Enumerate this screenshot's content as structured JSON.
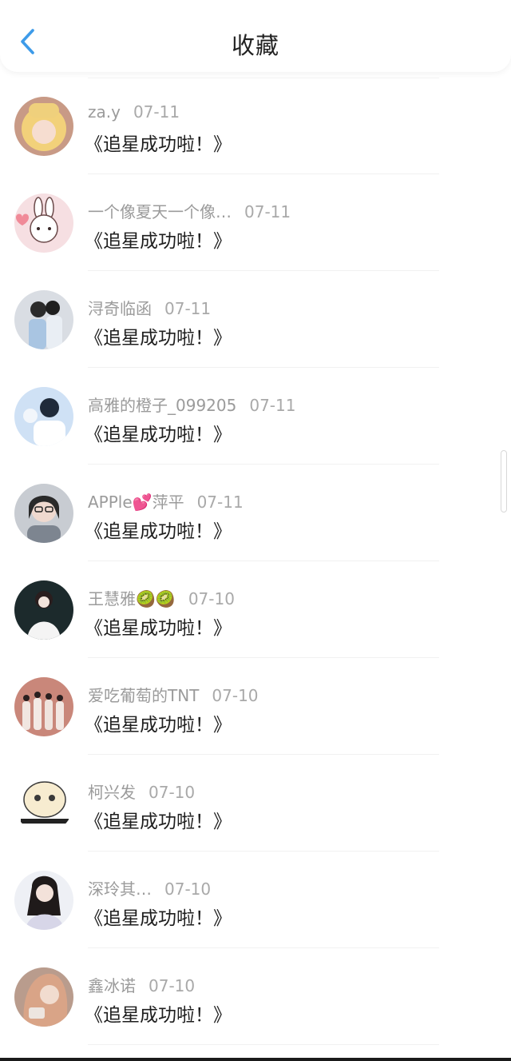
{
  "header": {
    "title": "收藏",
    "back_icon": "chevron-left-icon",
    "accent_color": "#3d9be9"
  },
  "favorites": [
    {
      "user": "za.y",
      "date": "07-11",
      "message": "《追星成功啦！》"
    },
    {
      "user": "一个像夏天一个像…",
      "date": "07-11",
      "message": "《追星成功啦！》"
    },
    {
      "user": "浔奇临函",
      "date": "07-11",
      "message": "《追星成功啦！》"
    },
    {
      "user": "高雅的橙子_099205",
      "date": "07-11",
      "message": "《追星成功啦！》"
    },
    {
      "user": "APPle💕萍平",
      "date": "07-11",
      "message": "《追星成功啦！》"
    },
    {
      "user": "王慧雅🥝🥝",
      "date": "07-10",
      "message": "《追星成功啦！》"
    },
    {
      "user": "爱吃葡萄的TNT",
      "date": "07-10",
      "message": "《追星成功啦！》"
    },
    {
      "user": "柯兴发",
      "date": "07-10",
      "message": "《追星成功啦！》"
    },
    {
      "user": "深玲其…",
      "date": "07-10",
      "message": "《追星成功啦！》"
    },
    {
      "user": "鑫冰诺",
      "date": "07-10",
      "message": "《追星成功啦！》"
    }
  ]
}
